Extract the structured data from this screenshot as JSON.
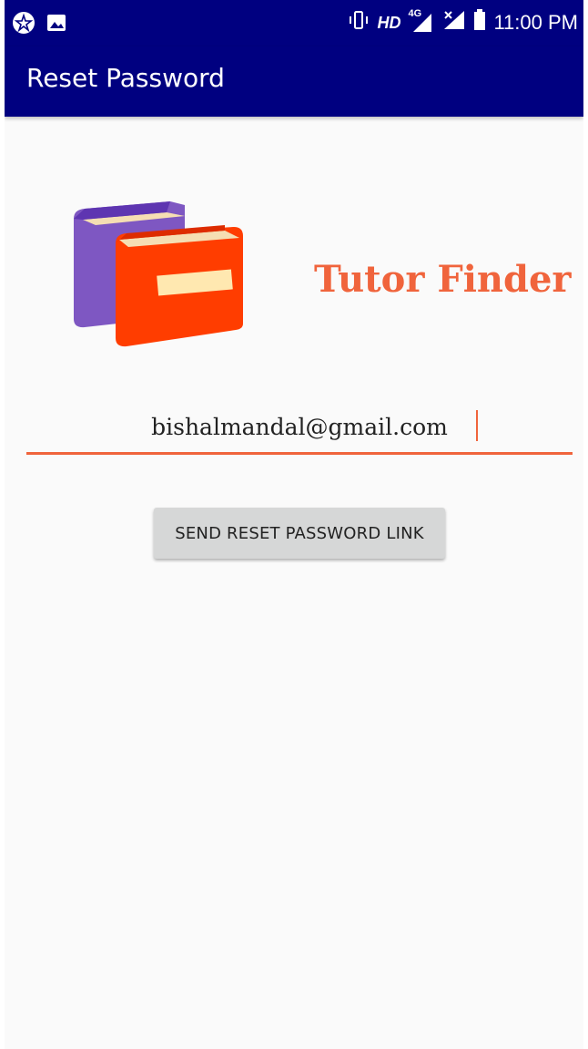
{
  "status_bar": {
    "left_icons": [
      "app-notification-icon",
      "image-icon"
    ],
    "right_icons": [
      "vibrate-icon",
      "hd-icon",
      "signal-4g-icon",
      "no-signal-icon",
      "battery-icon"
    ],
    "hd_label": "HD",
    "network_label": "4G",
    "time": "11:00 PM"
  },
  "toolbar": {
    "title": "Reset Password",
    "background": "#000080"
  },
  "brand": {
    "name": "Tutor Finder",
    "color": "#f0643c"
  },
  "form": {
    "email_value": "bishalmandal@gmail.com",
    "submit_label": "SEND RESET PASSWORD LINK",
    "accent": "#f0643c"
  }
}
